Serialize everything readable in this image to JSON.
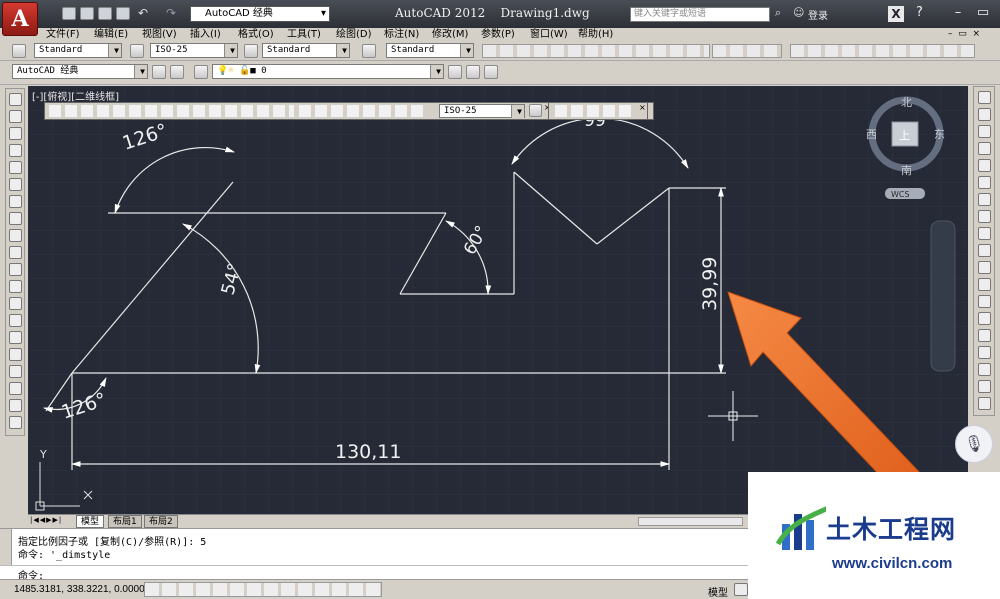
{
  "titlebar": {
    "app_logo": "A",
    "workspace": "AutoCAD 经典",
    "title": "AutoCAD 2012",
    "document": "Drawing1.dwg",
    "search_placeholder": "键入关键字或短语",
    "login": "登录"
  },
  "menu": [
    "文件(F)",
    "编辑(E)",
    "视图(V)",
    "插入(I)",
    "格式(O)",
    "工具(T)",
    "绘图(D)",
    "标注(N)",
    "修改(M)",
    "参数(P)",
    "窗口(W)",
    "帮助(H)"
  ],
  "styles_toolbar": {
    "text_style": "Standard",
    "dim_style": "ISO-25",
    "table_style": "Standard",
    "mleader_style": "Standard"
  },
  "layers_toolbar": {
    "workspace": "AutoCAD 经典",
    "layer": "0"
  },
  "viewport": {
    "label": "[-][俯视][二维线框]",
    "dim_style_combo": "ISO-25"
  },
  "viewcube": {
    "north": "北",
    "south": "南",
    "east": "东",
    "west": "西",
    "top_face": "上",
    "wcs": "WCS"
  },
  "dimensions": {
    "angle_top": "126°",
    "angle_mid": "54°",
    "angle_bottom": "126°",
    "angle_60": "60°",
    "angle_cut": "99",
    "vertical": "39,99",
    "horizontal": "130,11"
  },
  "ucs": {
    "y_label": "Y",
    "x_label": "X"
  },
  "tabs": [
    "模型",
    "布局1",
    "布局2"
  ],
  "command": {
    "line1": "指定比例因子或 [复制(C)/参照(R)]: 5",
    "line2": "命令: '_dimstyle",
    "prompt": "命令:"
  },
  "statusbar": {
    "coords": "1485.3181, 338.3221, 0.0000",
    "model": "模型"
  },
  "watermark": {
    "title": "土木工程网",
    "url": "www.civilcn.com"
  },
  "colors": {
    "canvas": "#252a36",
    "arrow": "#f07a35",
    "brand": "#1b3c8c"
  }
}
